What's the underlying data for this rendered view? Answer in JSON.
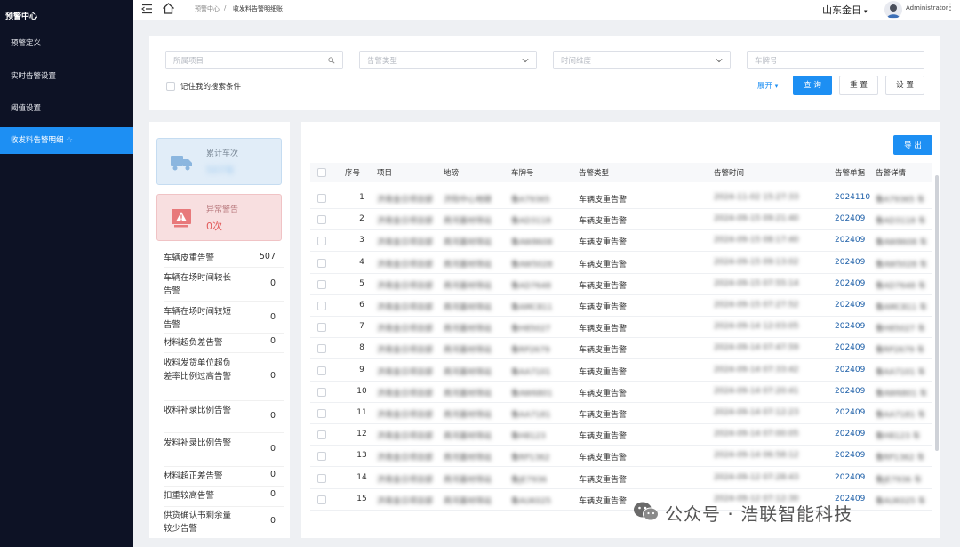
{
  "sidebar": {
    "title": "预警中心",
    "items": [
      {
        "label": "预警定义"
      },
      {
        "label": "实时告警设置"
      },
      {
        "label": "阈值设置"
      },
      {
        "label": "收发料告警明细"
      }
    ]
  },
  "topbar": {
    "breadcrumb": [
      "预警中心",
      "/",
      "收发料告警明细账"
    ],
    "company": "山东金日",
    "user": "Administrator"
  },
  "search": {
    "project_placeholder": "所属项目",
    "alarm_type_placeholder": "告警类型",
    "time_placeholder": "时间维度",
    "plate_placeholder": "车牌号",
    "remember_label": "记住我的搜索条件",
    "expand_label": "展开",
    "query_label": "查 询",
    "reset_label": "重 置",
    "settings_label": "设 置"
  },
  "stats": {
    "total_label": "累计车次",
    "total_value": "507车",
    "abnormal_label": "异常警告",
    "abnormal_value": "0次",
    "items": [
      {
        "label": "车辆皮重告警",
        "value": "507"
      },
      {
        "label": "车辆在场时间较长告警",
        "value": "0"
      },
      {
        "label": "车辆在场时间较短告警",
        "value": "0"
      },
      {
        "label": "材料超负差告警",
        "value": "0"
      },
      {
        "label": "收料发货单位超负差率比例过高告警",
        "value": "0"
      },
      {
        "label": "收料补录比例告警",
        "value": "0"
      },
      {
        "label": "发料补录比例告警",
        "value": "0"
      },
      {
        "label": "材料超正差告警",
        "value": "0"
      },
      {
        "label": "扣重较高告警",
        "value": "0"
      },
      {
        "label": "供货确认书剩余量较少告警",
        "value": "0"
      }
    ]
  },
  "table": {
    "export_label": "导 出",
    "headers": [
      "序号",
      "项目",
      "地磅",
      "车牌号",
      "告警类型",
      "告警时间",
      "告警单据",
      "告警详情"
    ],
    "rows": [
      {
        "no": "1",
        "project": "济南金日项目部",
        "scale": "济阳中心地磅",
        "plate": "鲁A79365",
        "type": "车辆皮重告警",
        "time": "2024-11-02 15:27:33",
        "doc": "2024110",
        "detail": "鲁A79365 车"
      },
      {
        "no": "2",
        "project": "济南金日项目部",
        "scale": "商河基材场站",
        "plate": "鲁AD3118",
        "type": "车辆皮重告警",
        "time": "2024-09-15 09:21:40",
        "doc": "202409",
        "detail": "鲁AD3118 车"
      },
      {
        "no": "3",
        "project": "济南金日项目部",
        "scale": "商河基材场站",
        "plate": "鲁AW8608",
        "type": "车辆皮重告警",
        "time": "2024-09-15 08:17:40",
        "doc": "202409",
        "detail": "鲁AW8608 车"
      },
      {
        "no": "4",
        "project": "济南金日项目部",
        "scale": "商河基材场站",
        "plate": "鲁AW5028",
        "type": "车辆皮重告警",
        "time": "2024-09-15 09:13:02",
        "doc": "202409",
        "detail": "鲁AW5028 车"
      },
      {
        "no": "5",
        "project": "济南金日项目部",
        "scale": "商河基材场站",
        "plate": "鲁AD7648",
        "type": "车辆皮重告警",
        "time": "2024-09-15 07:55:14",
        "doc": "202409",
        "detail": "鲁AD7648 车"
      },
      {
        "no": "6",
        "project": "济南金日项目部",
        "scale": "商河基材场站",
        "plate": "鲁AMC811",
        "type": "车辆皮重告警",
        "time": "2024-09-15 07:27:52",
        "doc": "202409",
        "detail": "鲁AMC811 车"
      },
      {
        "no": "7",
        "project": "济南金日项目部",
        "scale": "商河基材场站",
        "plate": "鲁H85027",
        "type": "车辆皮重告警",
        "time": "2024-09-14 12:03:05",
        "doc": "202409",
        "detail": "鲁H85027 车"
      },
      {
        "no": "8",
        "project": "济南金日项目部",
        "scale": "商河基材场站",
        "plate": "鲁RP2679",
        "type": "车辆皮重告警",
        "time": "2024-09-14 07:47:59",
        "doc": "202409",
        "detail": "鲁RP2679 车"
      },
      {
        "no": "9",
        "project": "济南金日项目部",
        "scale": "商河基材场站",
        "plate": "鲁AA7101",
        "type": "车辆皮重告警",
        "time": "2024-09-14 07:33:42",
        "doc": "202409",
        "detail": "鲁AA7101 车"
      },
      {
        "no": "10",
        "project": "济南金日项目部",
        "scale": "商河基材场站",
        "plate": "鲁AW6801",
        "type": "车辆皮重告警",
        "time": "2024-09-14 07:20:41",
        "doc": "202409",
        "detail": "鲁AW6801 车"
      },
      {
        "no": "11",
        "project": "济南金日项目部",
        "scale": "商河基材场站",
        "plate": "鲁AA7181",
        "type": "车辆皮重告警",
        "time": "2024-09-14 07:12:23",
        "doc": "202409",
        "detail": "鲁AA7181 车"
      },
      {
        "no": "12",
        "project": "济南金日项目部",
        "scale": "商河基材场站",
        "plate": "鲁H8123",
        "type": "车辆皮重告警",
        "time": "2024-09-14 07:00:05",
        "doc": "202409",
        "detail": "鲁H8123 车"
      },
      {
        "no": "13",
        "project": "济南金日项目部",
        "scale": "商河基材场站",
        "plate": "鲁RP1362",
        "type": "车辆皮重告警",
        "time": "2024-09-14 06:58:12",
        "doc": "202409",
        "detail": "鲁RP1362 车"
      },
      {
        "no": "14",
        "project": "济南金日项目部",
        "scale": "商河基材场站",
        "plate": "鲁JE7936",
        "type": "车辆皮重告警",
        "time": "2024-09-12 07:28:43",
        "doc": "202409",
        "detail": "鲁JE7936 车"
      },
      {
        "no": "15",
        "project": "济南金日项目部",
        "scale": "商河基材场站",
        "plate": "鲁AUK025",
        "type": "车辆皮重告警",
        "time": "2024-09-12 07:12:30",
        "doc": "202409",
        "detail": "鲁AUK025 车"
      }
    ]
  },
  "watermark": {
    "text": "公众号 · 浩联智能科技"
  },
  "colors": {
    "primary": "#1d8ff3",
    "sidebar_bg": "#0d1225",
    "link": "#1d5fa8"
  }
}
